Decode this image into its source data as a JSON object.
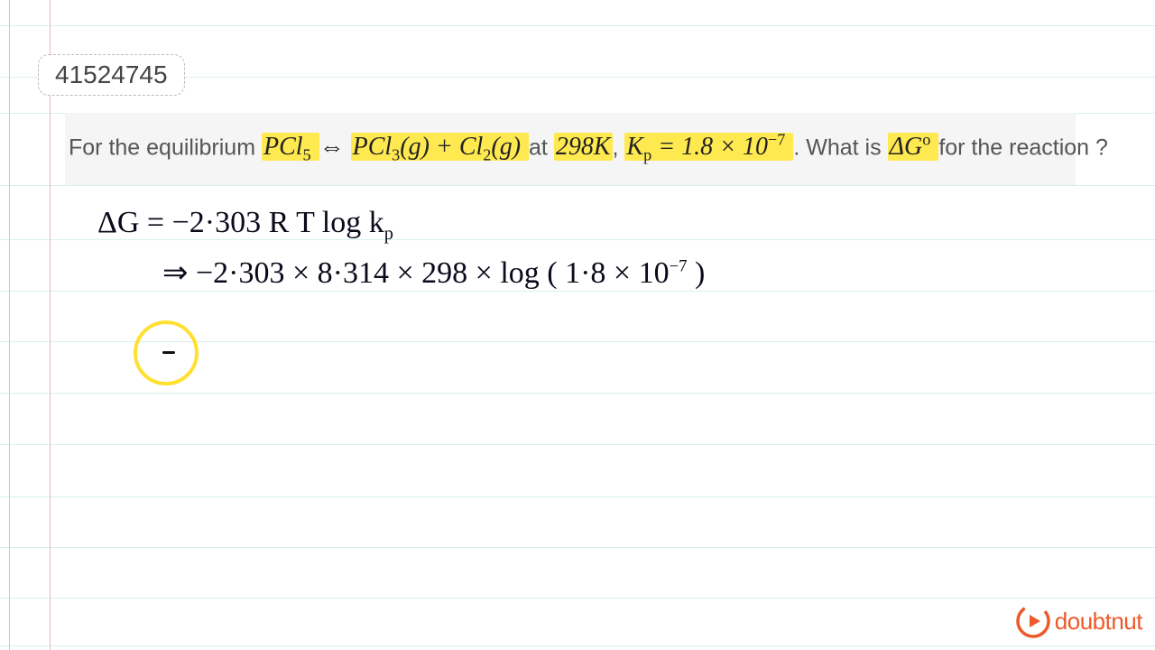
{
  "id_number": "41524745",
  "question": {
    "prefix": "For the equilibrium",
    "eq_lhs": "PCl",
    "eq_sub1": "5",
    "arrow": "⇔",
    "eq_rhs1": "PCl",
    "eq_sub2": "3",
    "g1": "(g)",
    "plus": " + ",
    "eq_rhs2": "Cl",
    "eq_sub3": "2",
    "g2": "(g)",
    "at": " at ",
    "temp": "298K",
    "comma": ", ",
    "kp": "K",
    "kp_sub": "p",
    "eq": " = ",
    "kpval": "1.8 × 10",
    "kpexp": "−7",
    "mid": ". What is ",
    "dg": "ΔG",
    "dg_sup": "o",
    "suffix": " for the reaction ?"
  },
  "hand": {
    "line1": "ΔG  =    −2·303  R T   log  k",
    "line1_sub": "p",
    "line2a": "⇒    −2·303 × 8·314 × 298   ×   log ( 1·8 × 10",
    "line2_exp": "−7",
    "line2b": " )"
  },
  "logo": {
    "text": "doubtnut"
  }
}
